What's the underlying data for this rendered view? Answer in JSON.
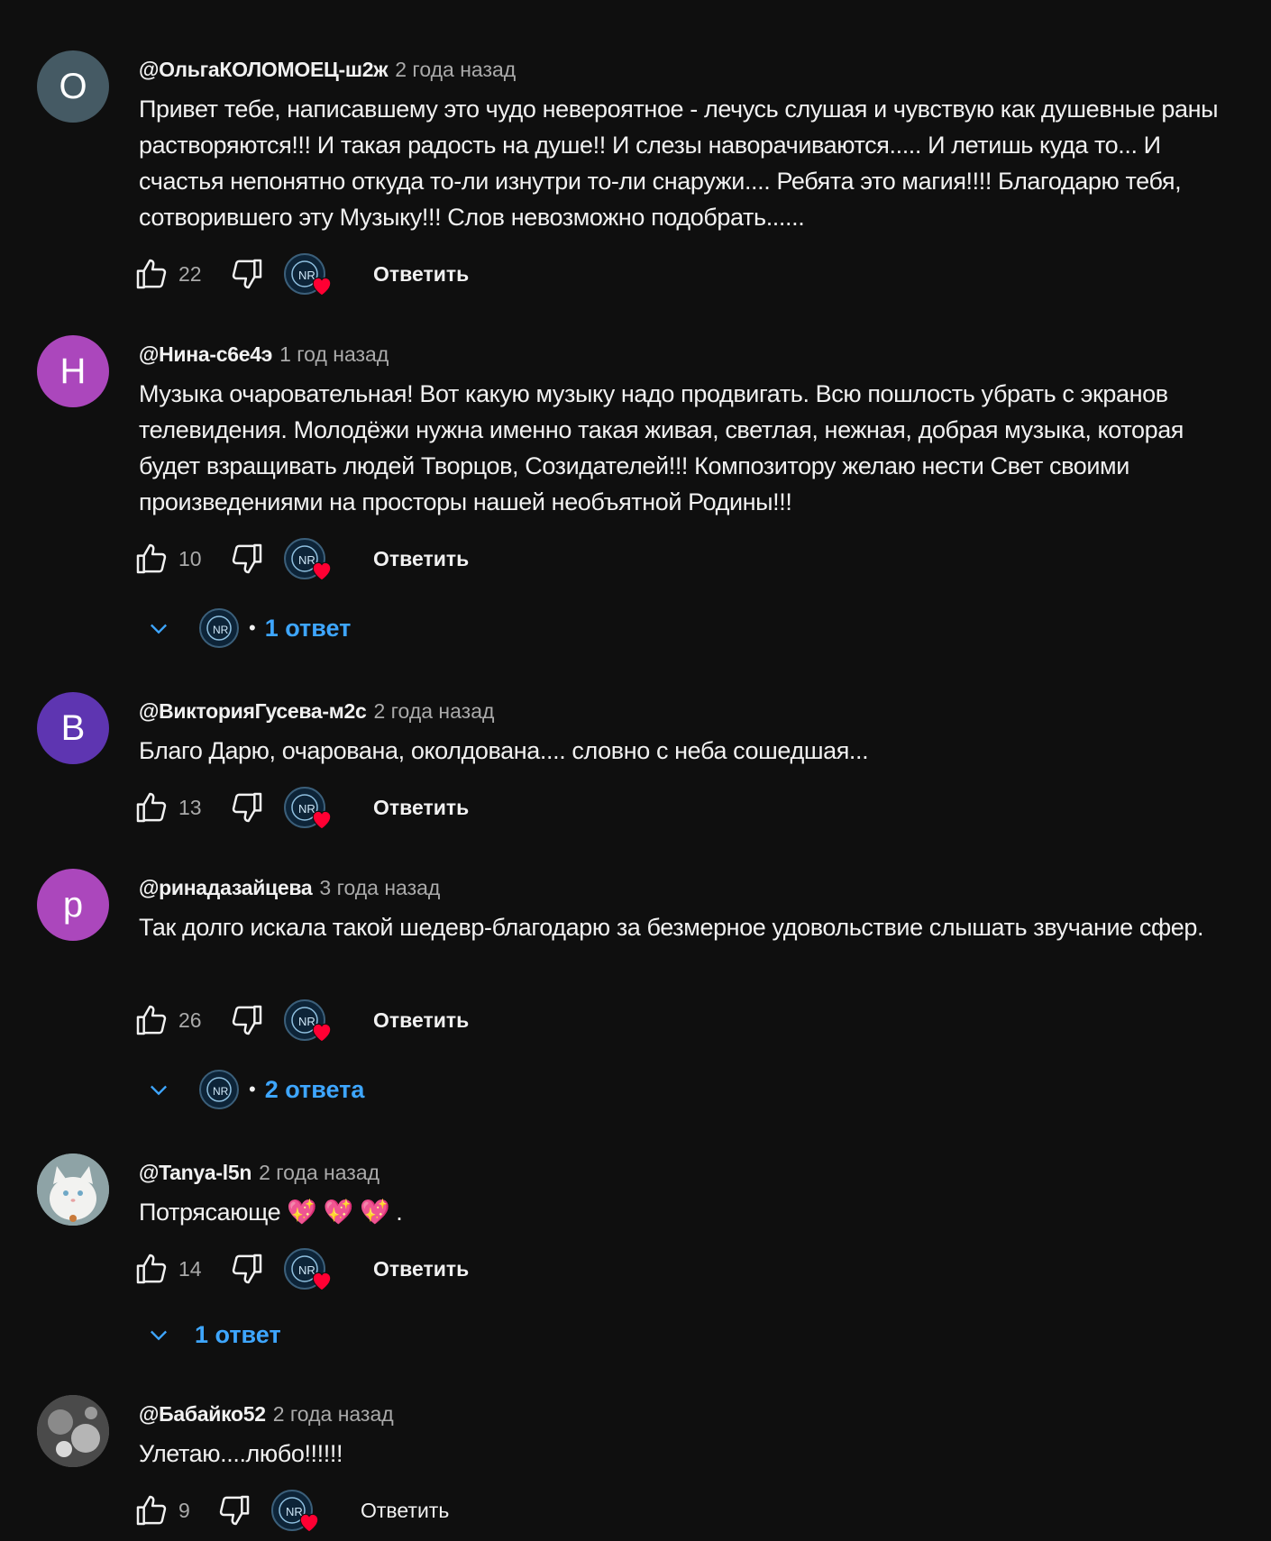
{
  "colors": {
    "background": "#0f0f0f",
    "text_primary": "#f1f1f1",
    "text_secondary": "#aaaaaa",
    "link_blue": "#3ea6ff",
    "heart_red": "#ff0033"
  },
  "comments": [
    {
      "author": "@ОльгаКОЛОМОЕЦ-ш2ж",
      "time": "2 года назад",
      "avatar_letter": "О",
      "avatar_color": "#455a64",
      "text": "Привет тебе, написавшему это чудо невероятное - лечусь слушая и чувствую как душевные раны растворяются!!! И такая радость на душе!! И слезы наворачиваются..... И летишь куда то... И счастья непонятно откуда то-ли изнутри то-ли снаружи.... Ребята это магия!!!! Благодарю тебя, сотворившего эту Музыку!!! Слов невозможно подобрать......",
      "likes": "22",
      "reply_label": "Ответить"
    },
    {
      "author": "@Нина-с6е4э",
      "time": "1 год назад",
      "avatar_letter": "Н",
      "avatar_color": "#ab47bc",
      "text": "Музыка очаровательная! Вот какую музыку надо продвигать. Всю пошлость убрать с экранов телевидения. Молодёжи нужна именно такая живая, светлая, нежная, добрая музыка, которая будет взращивать людей Творцов, Созидателей!!! Композитору желаю нести Свет своими произведениями на просторы нашей необъятной Родины!!!",
      "likes": "10",
      "reply_label": "Ответить",
      "replies": "1 ответ"
    },
    {
      "author": "@ВикторияГусева-м2с",
      "time": "2 года назад",
      "avatar_letter": "В",
      "avatar_color": "#5e35b1",
      "text": "Благо Дарю, очарована, околдована.... словно с неба сошедшая...",
      "likes": "13",
      "reply_label": "Ответить"
    },
    {
      "author": "@ринадазайцева",
      "time": "3 года назад",
      "avatar_letter": "р",
      "avatar_color": "#ab47bc",
      "text": "Так долго искала такой шедевр-благодарю за безмерное удовольствие слышать звучание сфер.",
      "likes": "26",
      "reply_label": "Ответить",
      "replies": "2 ответа"
    },
    {
      "author": "@Tanya-l5n",
      "time": "2 года назад",
      "avatar_icon": "white-cat-photo",
      "text": "Потрясающе 💖 💖 💖 .",
      "likes": "14",
      "reply_label": "Ответить",
      "replies": "1 ответ"
    },
    {
      "author": "@Бабайко52",
      "time": "2 года назад",
      "avatar_icon": "grey-photo",
      "text": "Улетаю....любо!!!!!!",
      "likes": "9",
      "reply_label": "Ответить"
    }
  ]
}
